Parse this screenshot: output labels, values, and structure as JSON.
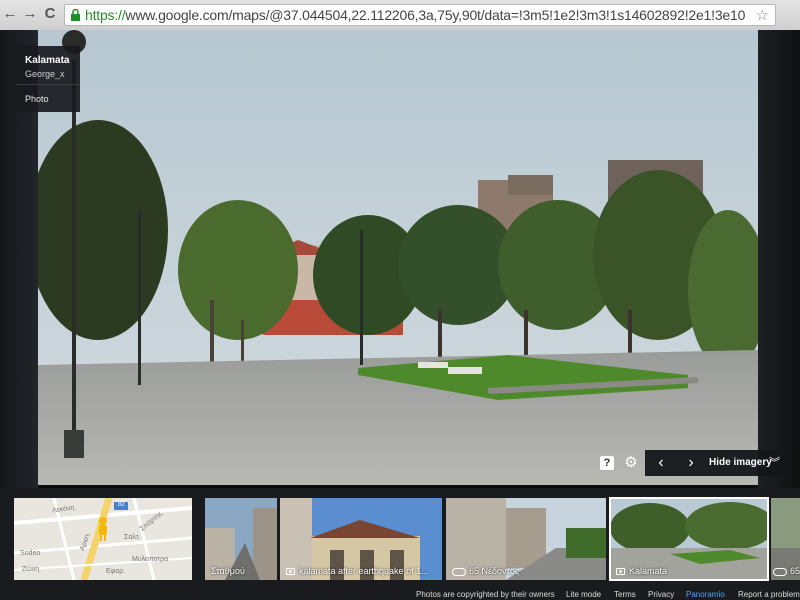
{
  "browser": {
    "url_scheme": "https://",
    "url_rest": "www.google.com/maps/@37.044504,22.112206,3a,75y,90t/data=!3m5!1e2!3m3!1s1460289",
    "url_tail": "2!2e1!3e10",
    "nav_back": "←",
    "nav_forward": "→",
    "nav_reload": "C",
    "star_glyph": "☆",
    "lock_color": "#2a8a2a"
  },
  "info_card": {
    "title": "Kalamata",
    "author": "George_x",
    "type": "Photo"
  },
  "controls": {
    "help": "?",
    "gear": "⚙",
    "prev": "‹",
    "next": "›",
    "hide_label": "Hide imagery",
    "hide_chevron": "︾"
  },
  "filmstrip": {
    "map_thumb": {
      "streets": [
        "Λεκόνη",
        "Σπάρτης",
        "Μυλοποτρα",
        "Αριστ.",
        "Εφαρ.",
        "Sodeo",
        "Σαλτ.",
        "Ζώνη"
      ],
      "marker": "pegman-icon",
      "badge": "82"
    },
    "photos": [
      {
        "label": "Σταθμού",
        "icon": "none"
      },
      {
        "label": "kalamata after earthquake of 1...",
        "icon": "camera-icon"
      },
      {
        "label": "65 Νέδοντος",
        "icon": "panorama-icon"
      },
      {
        "label": "Kalamata",
        "icon": "camera-icon",
        "selected": true
      },
      {
        "label": "65",
        "icon": "panorama-icon"
      }
    ]
  },
  "footer": {
    "photos_note": "Photos are copyrighted by their owners",
    "lite_mode": "Lite mode",
    "terms": "Terms",
    "privacy": "Privacy",
    "panoramio": "Panoramio",
    "report": "Report a problem"
  },
  "colors": {
    "link_blue": "#4fa3f5",
    "grass": "#4e8a2c",
    "sky": "#a9bfcc"
  }
}
